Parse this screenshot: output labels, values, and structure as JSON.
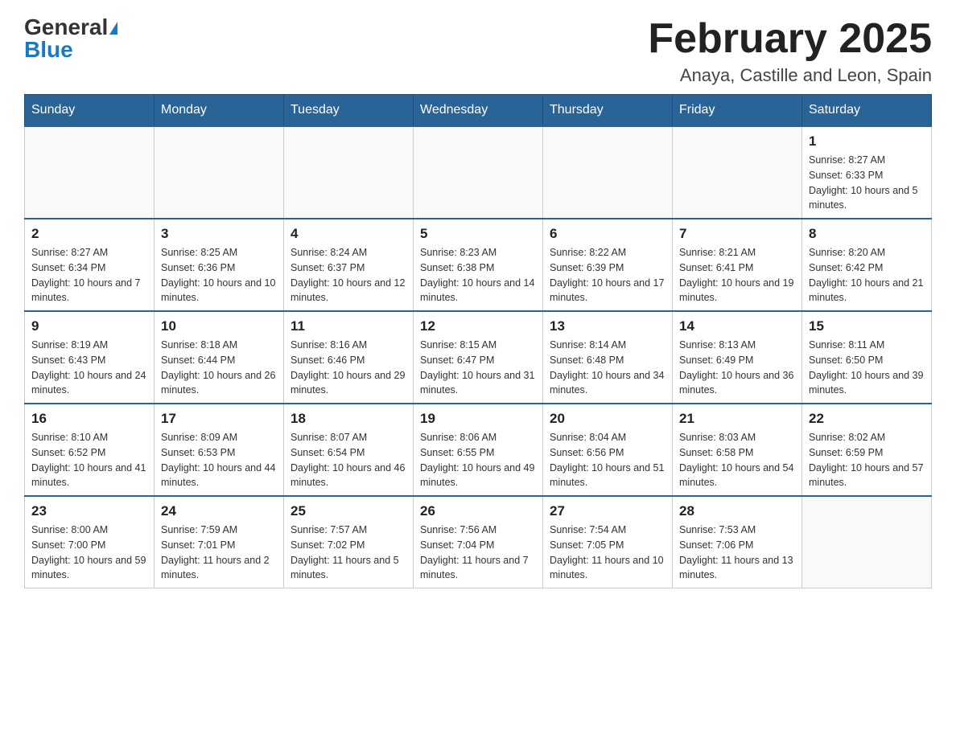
{
  "logo": {
    "general": "General",
    "blue": "Blue"
  },
  "title": "February 2025",
  "location": "Anaya, Castille and Leon, Spain",
  "days_of_week": [
    "Sunday",
    "Monday",
    "Tuesday",
    "Wednesday",
    "Thursday",
    "Friday",
    "Saturday"
  ],
  "weeks": [
    [
      {
        "day": "",
        "info": ""
      },
      {
        "day": "",
        "info": ""
      },
      {
        "day": "",
        "info": ""
      },
      {
        "day": "",
        "info": ""
      },
      {
        "day": "",
        "info": ""
      },
      {
        "day": "",
        "info": ""
      },
      {
        "day": "1",
        "info": "Sunrise: 8:27 AM\nSunset: 6:33 PM\nDaylight: 10 hours and 5 minutes."
      }
    ],
    [
      {
        "day": "2",
        "info": "Sunrise: 8:27 AM\nSunset: 6:34 PM\nDaylight: 10 hours and 7 minutes."
      },
      {
        "day": "3",
        "info": "Sunrise: 8:25 AM\nSunset: 6:36 PM\nDaylight: 10 hours and 10 minutes."
      },
      {
        "day": "4",
        "info": "Sunrise: 8:24 AM\nSunset: 6:37 PM\nDaylight: 10 hours and 12 minutes."
      },
      {
        "day": "5",
        "info": "Sunrise: 8:23 AM\nSunset: 6:38 PM\nDaylight: 10 hours and 14 minutes."
      },
      {
        "day": "6",
        "info": "Sunrise: 8:22 AM\nSunset: 6:39 PM\nDaylight: 10 hours and 17 minutes."
      },
      {
        "day": "7",
        "info": "Sunrise: 8:21 AM\nSunset: 6:41 PM\nDaylight: 10 hours and 19 minutes."
      },
      {
        "day": "8",
        "info": "Sunrise: 8:20 AM\nSunset: 6:42 PM\nDaylight: 10 hours and 21 minutes."
      }
    ],
    [
      {
        "day": "9",
        "info": "Sunrise: 8:19 AM\nSunset: 6:43 PM\nDaylight: 10 hours and 24 minutes."
      },
      {
        "day": "10",
        "info": "Sunrise: 8:18 AM\nSunset: 6:44 PM\nDaylight: 10 hours and 26 minutes."
      },
      {
        "day": "11",
        "info": "Sunrise: 8:16 AM\nSunset: 6:46 PM\nDaylight: 10 hours and 29 minutes."
      },
      {
        "day": "12",
        "info": "Sunrise: 8:15 AM\nSunset: 6:47 PM\nDaylight: 10 hours and 31 minutes."
      },
      {
        "day": "13",
        "info": "Sunrise: 8:14 AM\nSunset: 6:48 PM\nDaylight: 10 hours and 34 minutes."
      },
      {
        "day": "14",
        "info": "Sunrise: 8:13 AM\nSunset: 6:49 PM\nDaylight: 10 hours and 36 minutes."
      },
      {
        "day": "15",
        "info": "Sunrise: 8:11 AM\nSunset: 6:50 PM\nDaylight: 10 hours and 39 minutes."
      }
    ],
    [
      {
        "day": "16",
        "info": "Sunrise: 8:10 AM\nSunset: 6:52 PM\nDaylight: 10 hours and 41 minutes."
      },
      {
        "day": "17",
        "info": "Sunrise: 8:09 AM\nSunset: 6:53 PM\nDaylight: 10 hours and 44 minutes."
      },
      {
        "day": "18",
        "info": "Sunrise: 8:07 AM\nSunset: 6:54 PM\nDaylight: 10 hours and 46 minutes."
      },
      {
        "day": "19",
        "info": "Sunrise: 8:06 AM\nSunset: 6:55 PM\nDaylight: 10 hours and 49 minutes."
      },
      {
        "day": "20",
        "info": "Sunrise: 8:04 AM\nSunset: 6:56 PM\nDaylight: 10 hours and 51 minutes."
      },
      {
        "day": "21",
        "info": "Sunrise: 8:03 AM\nSunset: 6:58 PM\nDaylight: 10 hours and 54 minutes."
      },
      {
        "day": "22",
        "info": "Sunrise: 8:02 AM\nSunset: 6:59 PM\nDaylight: 10 hours and 57 minutes."
      }
    ],
    [
      {
        "day": "23",
        "info": "Sunrise: 8:00 AM\nSunset: 7:00 PM\nDaylight: 10 hours and 59 minutes."
      },
      {
        "day": "24",
        "info": "Sunrise: 7:59 AM\nSunset: 7:01 PM\nDaylight: 11 hours and 2 minutes."
      },
      {
        "day": "25",
        "info": "Sunrise: 7:57 AM\nSunset: 7:02 PM\nDaylight: 11 hours and 5 minutes."
      },
      {
        "day": "26",
        "info": "Sunrise: 7:56 AM\nSunset: 7:04 PM\nDaylight: 11 hours and 7 minutes."
      },
      {
        "day": "27",
        "info": "Sunrise: 7:54 AM\nSunset: 7:05 PM\nDaylight: 11 hours and 10 minutes."
      },
      {
        "day": "28",
        "info": "Sunrise: 7:53 AM\nSunset: 7:06 PM\nDaylight: 11 hours and 13 minutes."
      },
      {
        "day": "",
        "info": ""
      }
    ]
  ]
}
